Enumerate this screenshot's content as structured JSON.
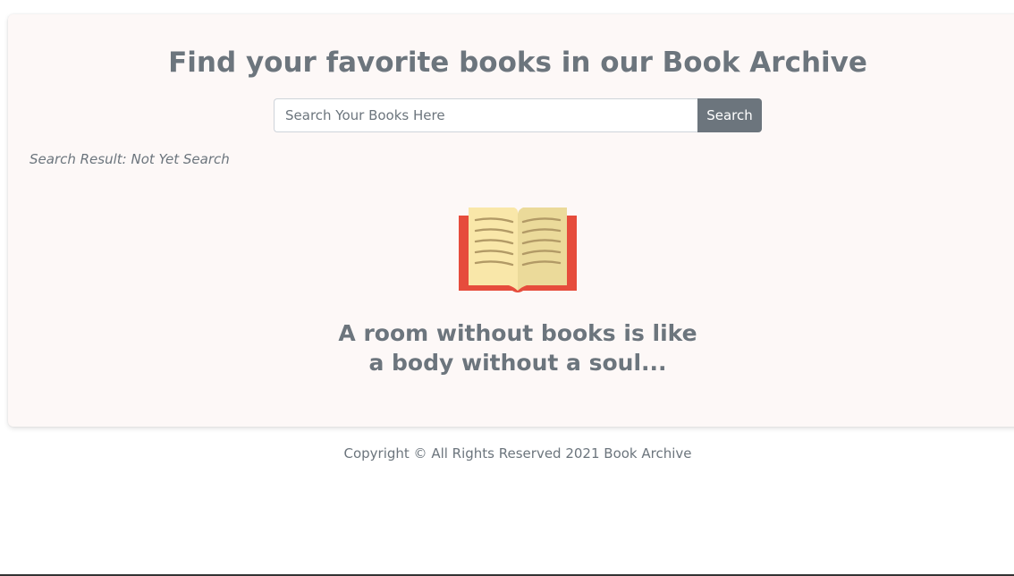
{
  "header": {
    "title": "Find your favorite books in our Book Archive"
  },
  "search": {
    "placeholder": "Search Your Books Here",
    "value": "",
    "button_label": "Search"
  },
  "result": {
    "status_text": "Search Result: Not Yet Search"
  },
  "hero": {
    "icon": "open-book-icon",
    "quote_line1": "A room without books is like",
    "quote_line2": "a body without a soul..."
  },
  "footer": {
    "copyright": "Copyright © All Rights Reserved 2021 Book Archive"
  },
  "colors": {
    "text_muted": "#6c757d",
    "card_background": "#fdf8f7",
    "button_background": "#6c757d",
    "book_cover": "#e64c3c",
    "book_pages": "#f9e7a9",
    "book_lines": "#b29a66"
  }
}
